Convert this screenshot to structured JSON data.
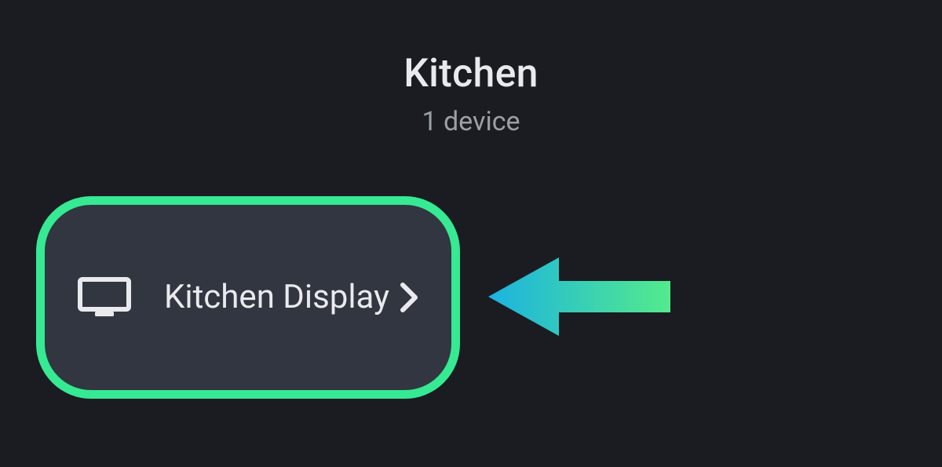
{
  "header": {
    "title": "Kitchen",
    "subtitle": "1 device"
  },
  "device": {
    "name": "Kitchen Display"
  },
  "colors": {
    "highlight": "#36e993",
    "arrow_start": "#1bb3e0",
    "arrow_end": "#54ea8c"
  }
}
